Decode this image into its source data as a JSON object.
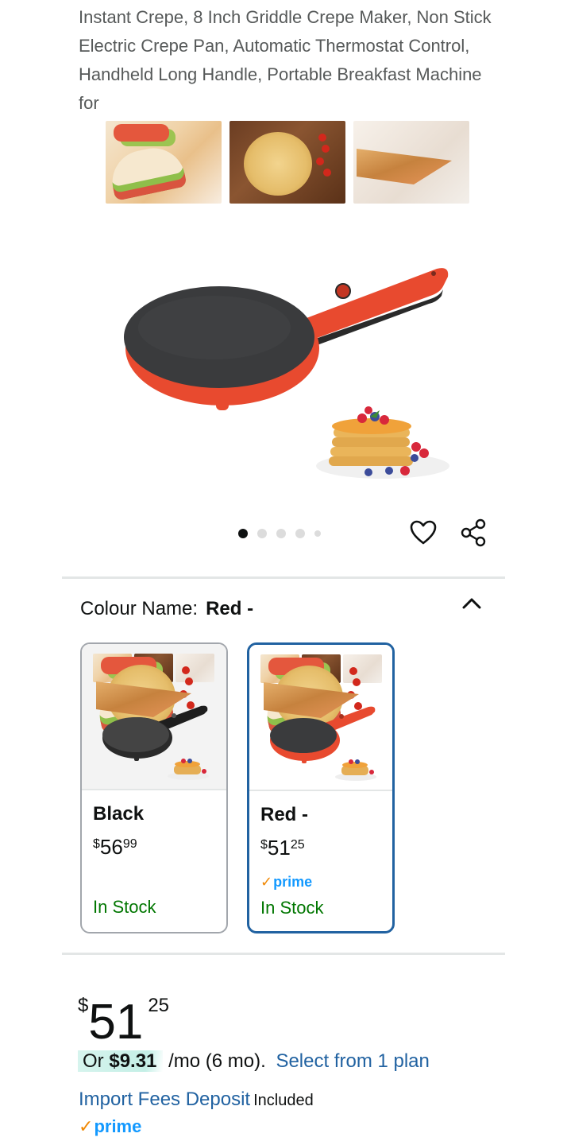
{
  "product": {
    "title": "Instant Crepe, 8 Inch Griddle Crepe Maker, Non Stick Electric Crepe Pan, Automatic Thermostat Control, Handheld Long Handle, Portable Breakfast Machine for"
  },
  "gallery": {
    "thumbnails": [
      "wraps-thumbnail",
      "crepe-thumbnail",
      "sandwich-thumbnail"
    ],
    "dots_total": 5,
    "active_dot": 1
  },
  "variation": {
    "label": "Colour Name:",
    "selected": "Red -",
    "options": [
      {
        "name": "Black",
        "price_symbol": "$",
        "price_whole": "56",
        "price_cents": "99",
        "prime": "",
        "stock": "In Stock",
        "color": "#3a3a3a"
      },
      {
        "name": "Red -",
        "price_symbol": "$",
        "price_whole": "51",
        "price_cents": "25",
        "prime": "prime",
        "stock": "In Stock",
        "color": "#e84a2f"
      }
    ]
  },
  "price": {
    "symbol": "$",
    "whole": "51",
    "cents": "25"
  },
  "installment": {
    "prefix": "Or",
    "amount": "$9.31",
    "suffix": "/mo (6 mo).",
    "link": "Select from 1 plan"
  },
  "import_fees": {
    "link": "Import Fees Deposit",
    "text": "Included"
  },
  "prime": {
    "check": "✓",
    "label": "prime"
  },
  "colors": {
    "link": "#2162a1",
    "in_stock": "#007600",
    "prime_blue": "#1399ff",
    "prime_check": "#f08804",
    "selected_border": "#2162a1",
    "product_red": "#e84a2f"
  }
}
